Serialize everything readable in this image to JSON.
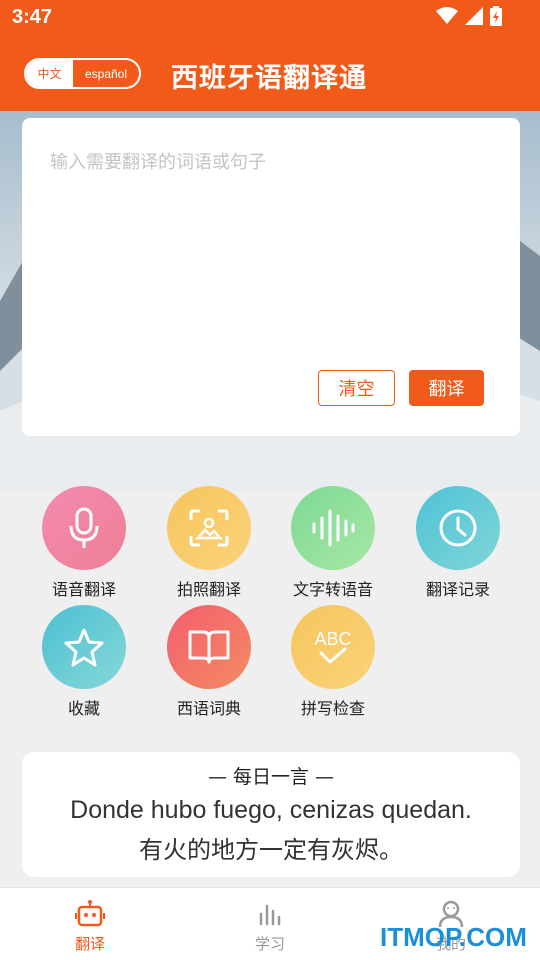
{
  "status_bar": {
    "time": "3:47"
  },
  "header": {
    "title": "西班牙语翻译通",
    "lang_toggle": {
      "active": "中文",
      "inactive": "español"
    }
  },
  "input": {
    "placeholder": "输入需要翻译的词语或句子",
    "value": "",
    "clear_label": "清空",
    "translate_label": "翻译"
  },
  "features": [
    {
      "label": "语音翻译",
      "icon": "microphone-icon"
    },
    {
      "label": "拍照翻译",
      "icon": "photo-scan-icon"
    },
    {
      "label": "文字转语音",
      "icon": "sound-wave-icon"
    },
    {
      "label": "翻译记录",
      "icon": "clock-icon"
    },
    {
      "label": "收藏",
      "icon": "star-icon"
    },
    {
      "label": "西语词典",
      "icon": "book-icon"
    },
    {
      "label": "拼写检查",
      "icon": "abc-check-icon"
    }
  ],
  "quote": {
    "title": "— 每日一言 —",
    "es": "Donde hubo fuego, cenizas quedan.",
    "zh": "有火的地方一定有灰烬。"
  },
  "bottom_nav": [
    {
      "label": "翻译",
      "icon": "robot-icon",
      "active": true
    },
    {
      "label": "学习",
      "icon": "bar-chart-icon",
      "active": false
    },
    {
      "label": "我的",
      "icon": "user-icon",
      "active": false
    }
  ],
  "watermark": "ITMOP.COM",
  "colors": {
    "accent": "#f25a1a",
    "inactive_nav": "#999999",
    "watermark": "#1c8fd8"
  }
}
